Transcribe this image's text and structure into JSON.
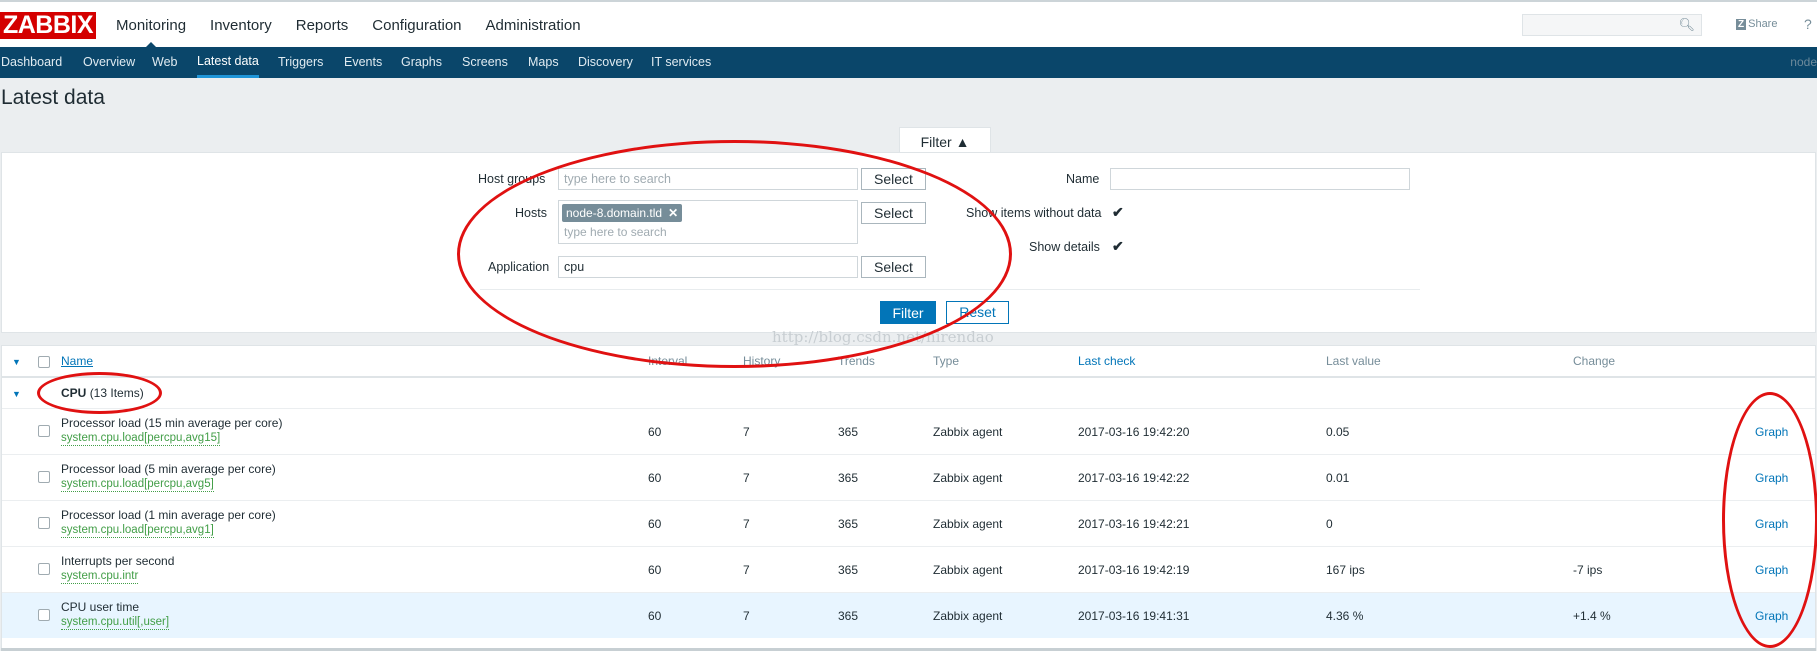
{
  "header": {
    "logo": "ZABBIX",
    "menu": [
      "Monitoring",
      "Inventory",
      "Reports",
      "Configuration",
      "Administration"
    ],
    "share_icon": "Z",
    "share": "Share",
    "help": "?"
  },
  "subnav": {
    "items": [
      "Dashboard",
      "Overview",
      "Web",
      "Latest data",
      "Triggers",
      "Events",
      "Graphs",
      "Screens",
      "Maps",
      "Discovery",
      "IT services"
    ],
    "server": "node"
  },
  "page_title": "Latest data",
  "filter": {
    "tab_label": "Filter ▲",
    "host_groups_label": "Host groups",
    "host_groups_placeholder": "type here to search",
    "hosts_label": "Hosts",
    "host_chip": "node-8.domain.tld",
    "hosts_placeholder": "type here to search",
    "application_label": "Application",
    "application_value": "cpu",
    "select_label": "Select",
    "name_label": "Name",
    "name_value": "",
    "show_without_data_label": "Show items without data",
    "show_details_label": "Show details",
    "show_without_data_checked": true,
    "show_details_checked": true,
    "filter_button": "Filter",
    "reset_button": "Reset"
  },
  "table": {
    "columns": {
      "name": "Name",
      "interval": "Interval",
      "history": "History",
      "trends": "Trends",
      "type": "Type",
      "last_check": "Last check",
      "last_value": "Last value",
      "change": "Change"
    },
    "group": {
      "name": "CPU",
      "count": "(13 Items)"
    },
    "rows": [
      {
        "name": "Processor load (15 min average per core)",
        "key": "system.cpu.load[percpu,avg15]",
        "interval": "60",
        "history": "7",
        "trends": "365",
        "type": "Zabbix agent",
        "last_check": "2017-03-16 19:42:20",
        "last_value": "0.05",
        "change": "",
        "link": "Graph"
      },
      {
        "name": "Processor load (5 min average per core)",
        "key": "system.cpu.load[percpu,avg5]",
        "interval": "60",
        "history": "7",
        "trends": "365",
        "type": "Zabbix agent",
        "last_check": "2017-03-16 19:42:22",
        "last_value": "0.01",
        "change": "",
        "link": "Graph"
      },
      {
        "name": "Processor load (1 min average per core)",
        "key": "system.cpu.load[percpu,avg1]",
        "interval": "60",
        "history": "7",
        "trends": "365",
        "type": "Zabbix agent",
        "last_check": "2017-03-16 19:42:21",
        "last_value": "0",
        "change": "",
        "link": "Graph"
      },
      {
        "name": "Interrupts per second",
        "key": "system.cpu.intr",
        "interval": "60",
        "history": "7",
        "trends": "365",
        "type": "Zabbix agent",
        "last_check": "2017-03-16 19:42:19",
        "last_value": "167 ips",
        "change": "-7 ips",
        "link": "Graph"
      },
      {
        "name": "CPU user time",
        "key": "system.cpu.util[,user]",
        "interval": "60",
        "history": "7",
        "trends": "365",
        "type": "Zabbix agent",
        "last_check": "2017-03-16 19:41:31",
        "last_value": "4.36 %",
        "change": "+1.4 %",
        "link": "Graph"
      }
    ]
  },
  "watermark": "http://blog.csdn.net/nirendao",
  "colors": {
    "brand": "#d40000",
    "nav": "#0a466a",
    "link": "#0275b8",
    "item_key": "#429e47",
    "annotation": "#e01111"
  }
}
